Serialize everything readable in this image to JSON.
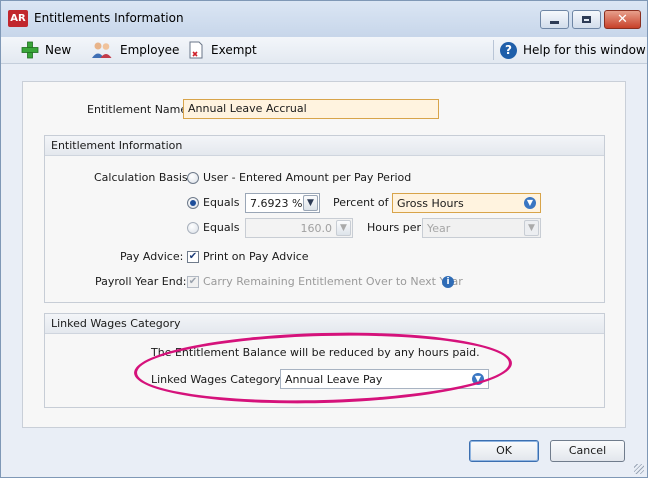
{
  "window": {
    "app_logo": "AR",
    "title": "Entitlements Information"
  },
  "toolbar": {
    "new_label": "New",
    "employee_label": "Employee",
    "exempt_label": "Exempt",
    "help_label": "Help for this window"
  },
  "entitlement_name": {
    "label": "Entitlement Name:",
    "value": "Annual Leave Accrual"
  },
  "entitlement_info": {
    "header": "Entitlement Information",
    "calc_basis_label": "Calculation Basis:",
    "option_user_label": "User - Entered Amount per Pay Period",
    "option_equals_percent": {
      "label": "Equals",
      "amount": "7.6923 %",
      "percent_of_label": "Percent of",
      "percent_of_value": "Gross Hours",
      "selected": true
    },
    "option_equals_hours": {
      "label": "Equals",
      "amount": "160.0",
      "hours_per_label": "Hours per",
      "hours_per_value": "Year"
    },
    "pay_advice_label": "Pay Advice:",
    "print_on_pay_advice_label": "Print on Pay Advice",
    "print_on_pay_advice_checked": true,
    "payroll_year_end_label": "Payroll Year End:",
    "carry_over_label": "Carry Remaining Entitlement Over to Next Year",
    "carry_over_checked": true
  },
  "linked_wages": {
    "header": "Linked Wages Category",
    "description": "The Entitlement Balance will be reduced by any hours paid.",
    "label": "Linked Wages Category:",
    "value": "Annual Leave Pay"
  },
  "buttons": {
    "ok": "OK",
    "cancel": "Cancel"
  },
  "colors": {
    "highlight_ellipse": "#d5127b",
    "required_field_bg": "#fff3df"
  }
}
